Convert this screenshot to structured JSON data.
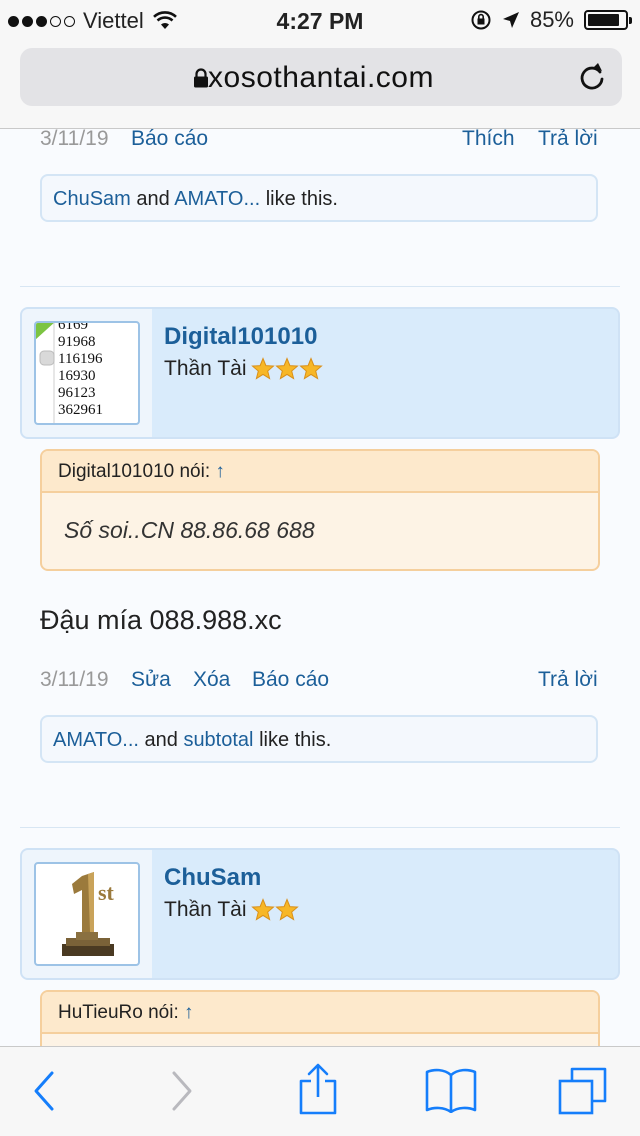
{
  "status_bar": {
    "carrier": "Viettel",
    "time": "4:27 PM",
    "battery": "85%",
    "battery_level": 0.85
  },
  "url_bar": {
    "host": "xosothantai.com"
  },
  "post1_footer": {
    "date": "3/11/19",
    "report": "Báo cáo",
    "like": "Thích",
    "reply": "Trả lời"
  },
  "post1_likes": {
    "user1": "ChuSam",
    "and": "and",
    "user2": "AMATO...",
    "suffix": "like this."
  },
  "post2": {
    "username": "Digital101010",
    "title": "Thần Tài",
    "stars": 3,
    "avatar_lines": [
      "6169",
      "91968",
      "116196",
      "16930",
      "96123",
      "362961"
    ],
    "quote_author": "Digital101010 nói:",
    "quote_arrow": "↑",
    "quote_text": "Số soi..CN 88.86.68 688",
    "text": "Đậu mía 088.988.xc",
    "date": "3/11/19",
    "edit": "Sửa",
    "delete": "Xóa",
    "report": "Báo cáo",
    "reply": "Trả lời",
    "likes": {
      "user1": "AMATO...",
      "and": "and",
      "user2": "subtotal",
      "suffix": "like this."
    }
  },
  "post3": {
    "username": "ChuSam",
    "title": "Thần Tài",
    "stars": 2,
    "quote_author": "HuTieuRo nói:",
    "quote_arrow": "↑"
  },
  "colors": {
    "link": "#1c5f99",
    "user_bar": "#d9ebfb",
    "quote_bg": "#fdf3e5",
    "quote_head": "#fde9cc",
    "ios_blue": "#157efb"
  },
  "icons": [
    "wifi-icon",
    "lock-rotation-icon",
    "location-arrow-icon",
    "battery-icon",
    "lock-icon",
    "reload-icon",
    "back-icon",
    "forward-icon",
    "share-icon",
    "bookmarks-icon",
    "tabs-icon",
    "star-icon"
  ]
}
